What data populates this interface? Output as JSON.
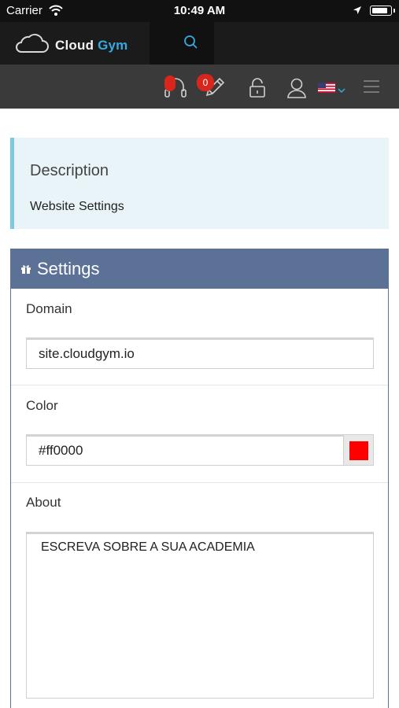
{
  "status_bar": {
    "carrier": "Carrier",
    "time": "10:49 AM"
  },
  "header": {
    "logo_text_1": "Cloud",
    "logo_text_2": "Gym",
    "accent_color": "#36a9e1"
  },
  "toolbar": {
    "notifications_count": "0",
    "icons": [
      "headset-icon",
      "pencil-icon",
      "lock-icon",
      "user-icon",
      "us-flag-icon",
      "menu-icon"
    ],
    "badge_color": "#d9261c"
  },
  "description": {
    "title": "Description",
    "text": "Website Settings"
  },
  "settings": {
    "title": "Settings",
    "header_color": "#5b7196",
    "domain": {
      "label": "Domain",
      "value": "site.cloudgym.io"
    },
    "color": {
      "label": "Color",
      "value": "#ff0000",
      "swatch": "#ff0000"
    },
    "about": {
      "label": "About",
      "value": "ESCREVA SOBRE A SUA ACADEMIA"
    }
  }
}
